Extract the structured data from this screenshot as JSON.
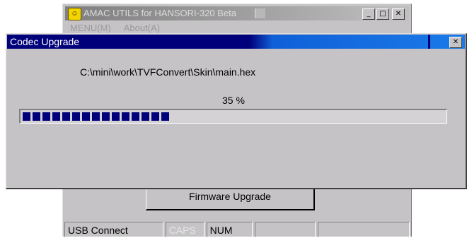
{
  "main_window": {
    "title": "AMAC UTILS for HANSORI-320 Beta",
    "icon": "app-smiley-icon",
    "menu": [
      "MENU(M)",
      "About(A)"
    ],
    "firmware_button": "Firmware Upgrade",
    "status_panes": [
      "USB Connect",
      "CAPS",
      "NUM"
    ],
    "window_buttons": [
      "minimize-icon",
      "maximize-icon",
      "close-icon"
    ]
  },
  "dialog": {
    "title": "Codec Upgrade",
    "file_path": "C:\\mini\\work\\TVFConvert\\Skin\\main.hex",
    "percent_text": "35 %",
    "progress": 0.35
  },
  "colors": {
    "active_title": "#00007b",
    "inactive_title": "#808080",
    "face": "#c6c3c6"
  }
}
